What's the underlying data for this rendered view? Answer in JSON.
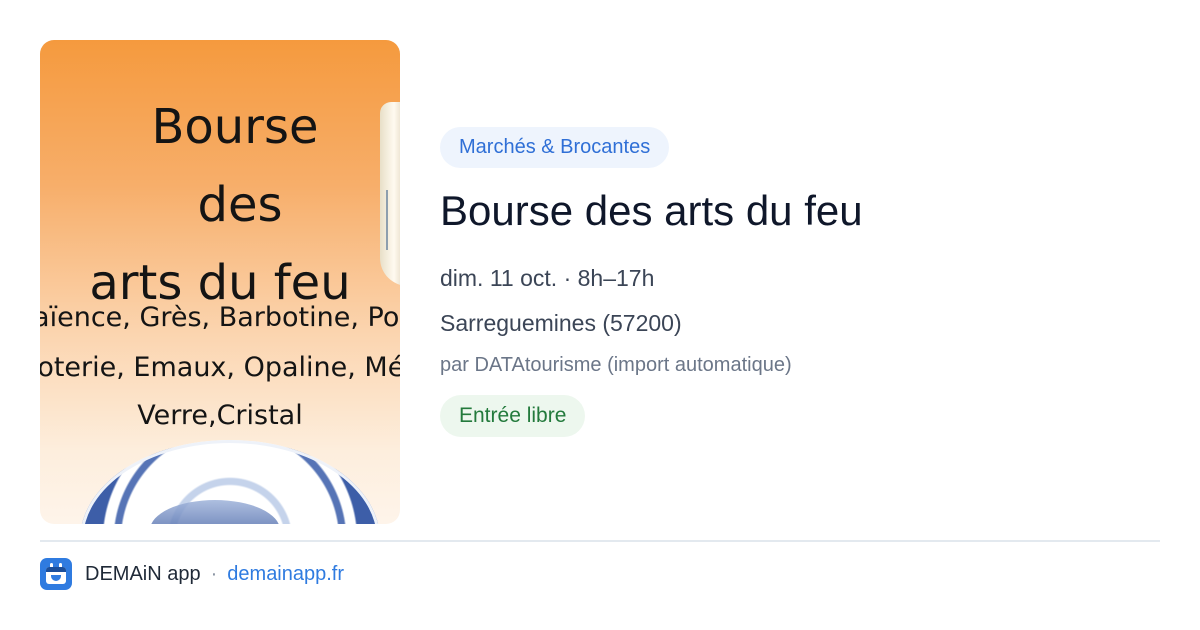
{
  "poster": {
    "title_line1": "Bourse",
    "title_line2": "des",
    "title_line3": "arts du feu",
    "line1": "Faïence, Grès, Barbotine, Porcelaine",
    "line2": "Poterie, Emaux, Opaline, Métal",
    "line3": "Verre,Cristal"
  },
  "event": {
    "category": "Marchés & Brocantes",
    "title": "Bourse des arts du feu",
    "datetime": "dim. 11 oct. · 8h–17h",
    "location": "Sarreguemines (57200)",
    "source": "par DATAtourisme (import automatique)",
    "price": "Entrée libre"
  },
  "footer": {
    "app_icon": "calendar-mascot-icon",
    "app_name": "DEMAiN app",
    "separator": "·",
    "site": "demainapp.fr"
  },
  "colors": {
    "accent_blue": "#2f7be0",
    "chip_bg": "#eef4fd",
    "price_green": "#237a3c",
    "price_bg": "#edf7ee",
    "poster_orange": "#f59a3e"
  }
}
